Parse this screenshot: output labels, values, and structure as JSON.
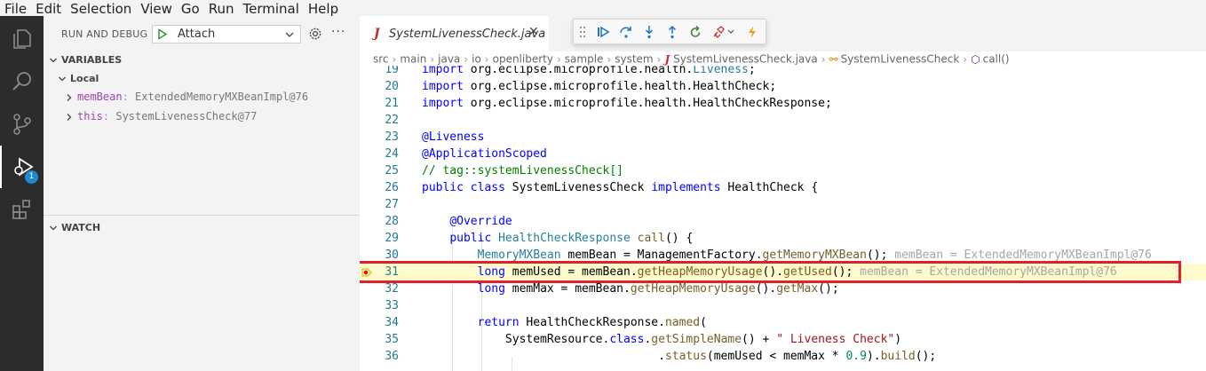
{
  "menu": [
    "File",
    "Edit",
    "Selection",
    "View",
    "Go",
    "Run",
    "Terminal",
    "Help"
  ],
  "activity_bar": {
    "items": [
      "files-icon",
      "search-icon",
      "source-control-icon",
      "run-debug-icon",
      "extensions-icon"
    ],
    "debug_badge": "1"
  },
  "run_debug": {
    "title": "RUN AND DEBUG",
    "config": "Attach"
  },
  "variables": {
    "title": "VARIABLES",
    "scope": "Local",
    "items": [
      {
        "name": "memBean",
        "value": "ExtendedMemoryMXBeanImpl@76"
      },
      {
        "name": "this",
        "value": "SystemLivenessCheck@77"
      }
    ]
  },
  "watch": {
    "title": "WATCH"
  },
  "editor": {
    "tab_label": "SystemLivenessCheck.java",
    "breadcrumb": [
      "src",
      "main",
      "java",
      "io",
      "openliberty",
      "sample",
      "system",
      "SystemLivenessCheck.java",
      "SystemLivenessCheck",
      "call()"
    ],
    "current_line": 31,
    "inline_value": "memBean = ExtendedMemoryMXBeanImpl@76"
  },
  "colors": {
    "highlight_border": "#e0202a",
    "current_line_bg": "#fffbcc",
    "activity_bg": "#2c2c2c",
    "badge": "#1f8ad2"
  }
}
